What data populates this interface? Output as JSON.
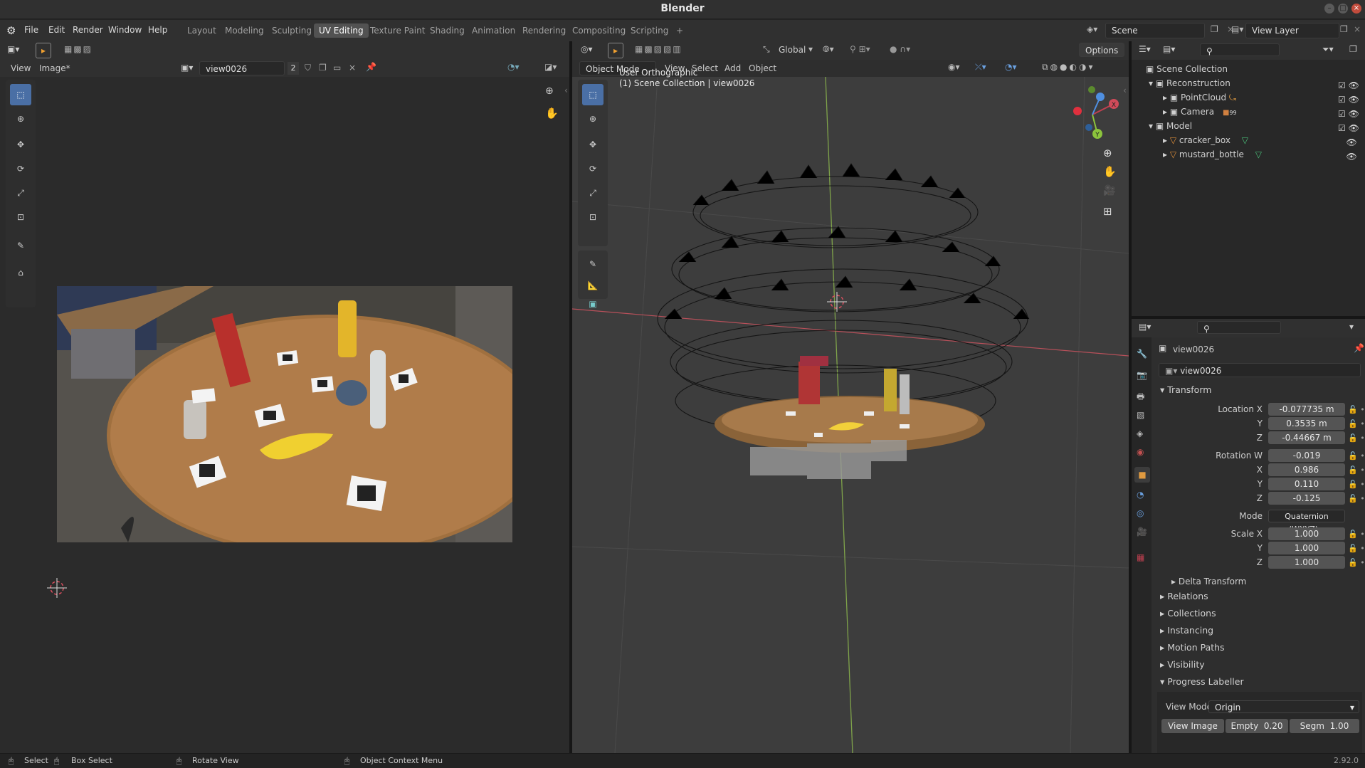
{
  "window": {
    "title": "Blender"
  },
  "menu": {
    "items": [
      "File",
      "Edit",
      "Render",
      "Window",
      "Help"
    ]
  },
  "workspaces": [
    "Layout",
    "Modeling",
    "Sculpting",
    "UV Editing",
    "Texture Paint",
    "Shading",
    "Animation",
    "Rendering",
    "Compositing",
    "Scripting",
    "+"
  ],
  "active_workspace": "UV Editing",
  "scene": {
    "name": "Scene",
    "view_layer": "View Layer"
  },
  "image_editor": {
    "menus": [
      "View",
      "Image*"
    ],
    "image_name": "view0026",
    "users": "2"
  },
  "viewport": {
    "transform_orientation": "Global",
    "options_label": "Options",
    "mode": "Object Mode",
    "menus": [
      "View",
      "Select",
      "Add",
      "Object"
    ],
    "overlay_text": [
      "User Orthographic",
      "(1) Scene Collection | view0026"
    ],
    "gizmo_axes": [
      "X",
      "Y",
      "Z"
    ]
  },
  "outliner": {
    "root": "Scene Collection",
    "items": [
      {
        "name": "Reconstruction",
        "level": 1,
        "type": "collection"
      },
      {
        "name": "PointCloud",
        "level": 2,
        "type": "collection"
      },
      {
        "name": "Camera",
        "level": 2,
        "type": "collection",
        "badge": "99"
      },
      {
        "name": "Model",
        "level": 1,
        "type": "collection"
      },
      {
        "name": "cracker_box",
        "level": 2,
        "type": "mesh"
      },
      {
        "name": "mustard_bottle",
        "level": 2,
        "type": "mesh"
      }
    ]
  },
  "properties": {
    "object_name": "view0026",
    "data_name": "view0026",
    "transform_header": "Transform",
    "location": {
      "label": "Location X",
      "x": "-0.077735 m",
      "y": "0.3535 m",
      "z": "-0.44667 m"
    },
    "rotation": {
      "label": "Rotation W",
      "w": "-0.019",
      "x": "0.986",
      "y": "0.110",
      "z": "-0.125"
    },
    "mode_label": "Mode",
    "mode_value": "Quaternion (WXYZ)",
    "scale": {
      "label": "Scale X",
      "x": "1.000",
      "y": "1.000",
      "z": "1.000"
    },
    "axis_labels": [
      "Y",
      "Z",
      "X"
    ],
    "collapsed_panels": [
      "Delta Transform",
      "Relations",
      "Collections",
      "Instancing",
      "Motion Paths",
      "Visibility"
    ],
    "addon_panel": "Progress Labeller",
    "view_mode_label": "View Mode:",
    "view_mode_value": "Origin",
    "buttons": [
      {
        "label": "View Image"
      },
      {
        "label": "Empty",
        "value": "0.20"
      },
      {
        "label": "Segm",
        "value": "1.00"
      }
    ]
  },
  "statusbar": {
    "items": [
      "Select",
      "Box Select",
      "Rotate View",
      "Object Context Menu"
    ],
    "version": "2.92.0"
  },
  "colors": {
    "accent": "#4a6fa5",
    "active_tab": "#525252",
    "x_axis": "#e04f5f",
    "y_axis": "#8cc43c",
    "z_axis": "#4f8fe0"
  }
}
